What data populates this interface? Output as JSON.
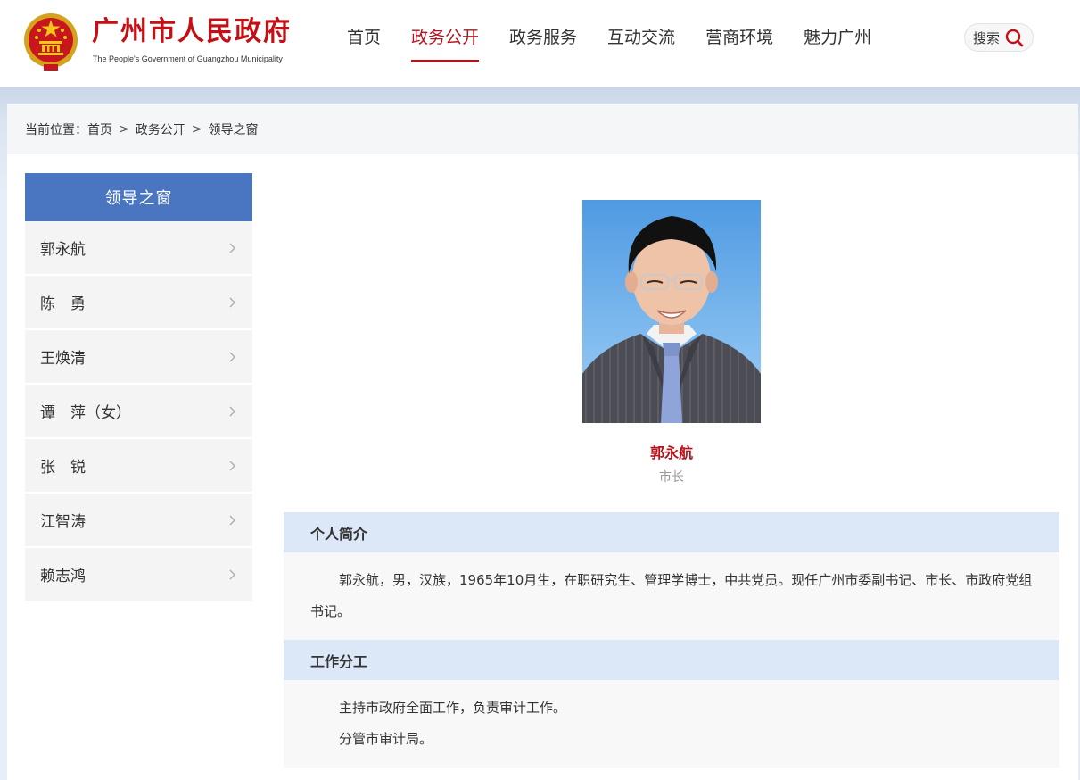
{
  "header": {
    "site_name_cn": "广州市人民政府",
    "site_name_en": "The People's Government of Guangzhou Municipality",
    "nav": [
      {
        "label": "首页",
        "active": false
      },
      {
        "label": "政务公开",
        "active": true
      },
      {
        "label": "政务服务",
        "active": false
      },
      {
        "label": "互动交流",
        "active": false
      },
      {
        "label": "营商环境",
        "active": false
      },
      {
        "label": "魅力广州",
        "active": false
      }
    ],
    "search_label": "搜索"
  },
  "breadcrumb": {
    "prefix": "当前位置：",
    "items": [
      "首页",
      "政务公开",
      "领导之窗"
    ],
    "separator": ">"
  },
  "sidebar": {
    "title": "领导之窗",
    "items": [
      {
        "label": "郭永航"
      },
      {
        "label": "陈　勇"
      },
      {
        "label": "王焕清"
      },
      {
        "label": "谭　萍（女）"
      },
      {
        "label": "张　锐"
      },
      {
        "label": "江智涛"
      },
      {
        "label": "赖志鸿"
      }
    ]
  },
  "profile": {
    "name": "郭永航",
    "title": "市长",
    "sections": [
      {
        "heading": "个人简介",
        "paragraphs": [
          "郭永航，男，汉族，1965年10月生，在职研究生、管理学博士，中共党员。现任广州市委副书记、市长、市政府党组书记。"
        ]
      },
      {
        "heading": "工作分工",
        "paragraphs": [
          "主持市政府全面工作，负责审计工作。",
          "分管市审计局。"
        ]
      }
    ]
  },
  "colors": {
    "brand_red": "#c40f14",
    "nav_active": "#b5121b",
    "sidebar_title_bg": "#4a76c1",
    "section_head_bg": "#dce7f7"
  }
}
